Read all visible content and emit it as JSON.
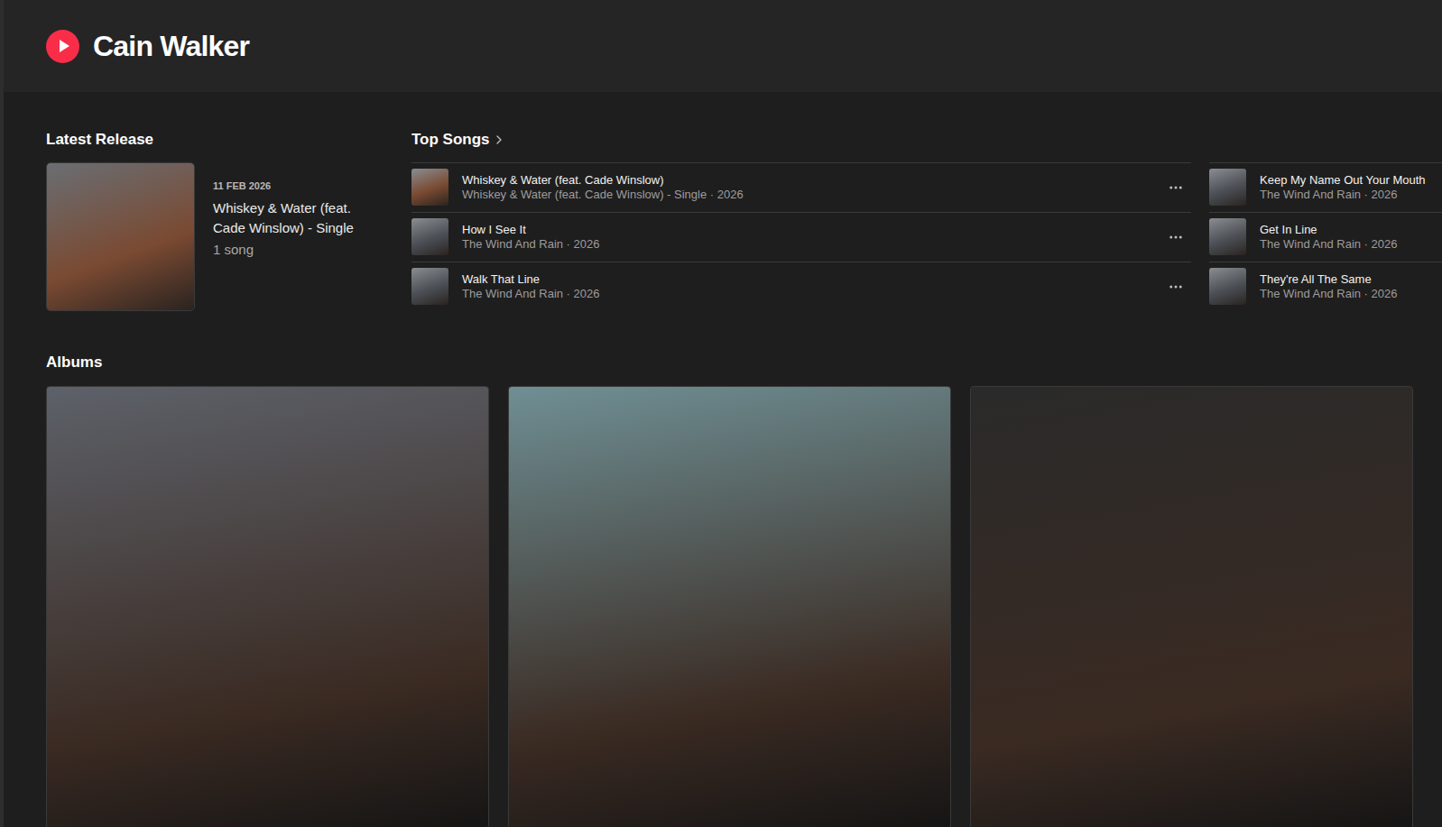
{
  "artist": {
    "name": "Cain Walker"
  },
  "latest_release": {
    "heading": "Latest Release",
    "date": "11 FEB 2026",
    "title": "Whiskey & Water (feat. Cade Winslow) - Single",
    "count": "1 song",
    "color": "#7a4a32"
  },
  "top_songs": {
    "heading": "Top Songs",
    "songs": [
      {
        "title": "Whiskey & Water (feat. Cade Winslow)",
        "subtitle": "Whiskey & Water (feat. Cade Winslow) - Single · 2026",
        "color": "#7a4a32"
      },
      {
        "title": "How I See It",
        "subtitle": "The Wind And Rain · 2026",
        "color": "#4b4f55"
      },
      {
        "title": "Walk That Line",
        "subtitle": "The Wind And Rain · 2026",
        "color": "#4b4f55"
      },
      {
        "title": "Keep My Name Out Your Mouth",
        "subtitle": "The Wind And Rain · 2026",
        "color": "#4b4f55"
      },
      {
        "title": "Get In Line",
        "subtitle": "The Wind And Rain · 2026",
        "color": "#4b4f55"
      },
      {
        "title": "They're All The Same",
        "subtitle": "The Wind And Rain · 2026",
        "color": "#4b4f55"
      }
    ]
  },
  "albums": {
    "heading": "Albums",
    "items": [
      {
        "color": "#5d6169"
      },
      {
        "color": "#6f8f94"
      },
      {
        "color": "#2a2a2a"
      }
    ]
  }
}
